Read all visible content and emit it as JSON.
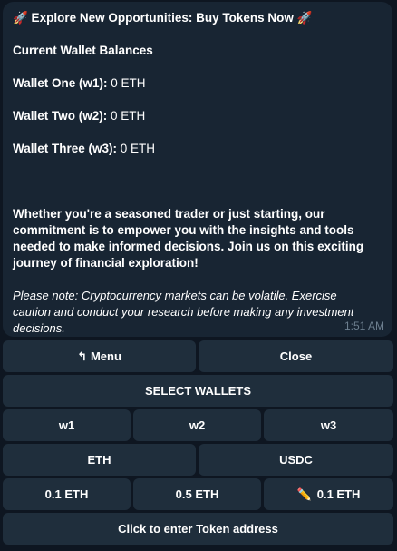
{
  "message": {
    "title": "🚀 Explore New Opportunities: Buy Tokens Now 🚀",
    "balances_heading": "Current Wallet Balances",
    "wallets": [
      {
        "label": "Wallet One (w1):",
        "value": "0 ETH"
      },
      {
        "label": "Wallet Two (w2):",
        "value": "0 ETH"
      },
      {
        "label": "Wallet Three (w3):",
        "value": "0 ETH"
      }
    ],
    "paragraph": "Whether you're a seasoned trader or just starting, our commitment is to empower you with the insights and tools needed to make informed decisions. Join us on this exciting journey of financial exploration!",
    "note": "Please note: Cryptocurrency markets can be volatile. Exercise caution and conduct your research before making any investment decisions.",
    "time": "1:51 AM"
  },
  "keyboard": {
    "menu": {
      "icon": "↰",
      "label": "Menu"
    },
    "close": "Close",
    "select_wallets": "SELECT WALLETS",
    "w1": "w1",
    "w2": "w2",
    "w3": "w3",
    "eth": "ETH",
    "usdc": "USDC",
    "amount1": "0.1 ETH",
    "amount2": "0.5 ETH",
    "amount_custom": {
      "icon": "✏️",
      "label": "0.1 ETH"
    },
    "token_address": "Click to enter Token address"
  }
}
